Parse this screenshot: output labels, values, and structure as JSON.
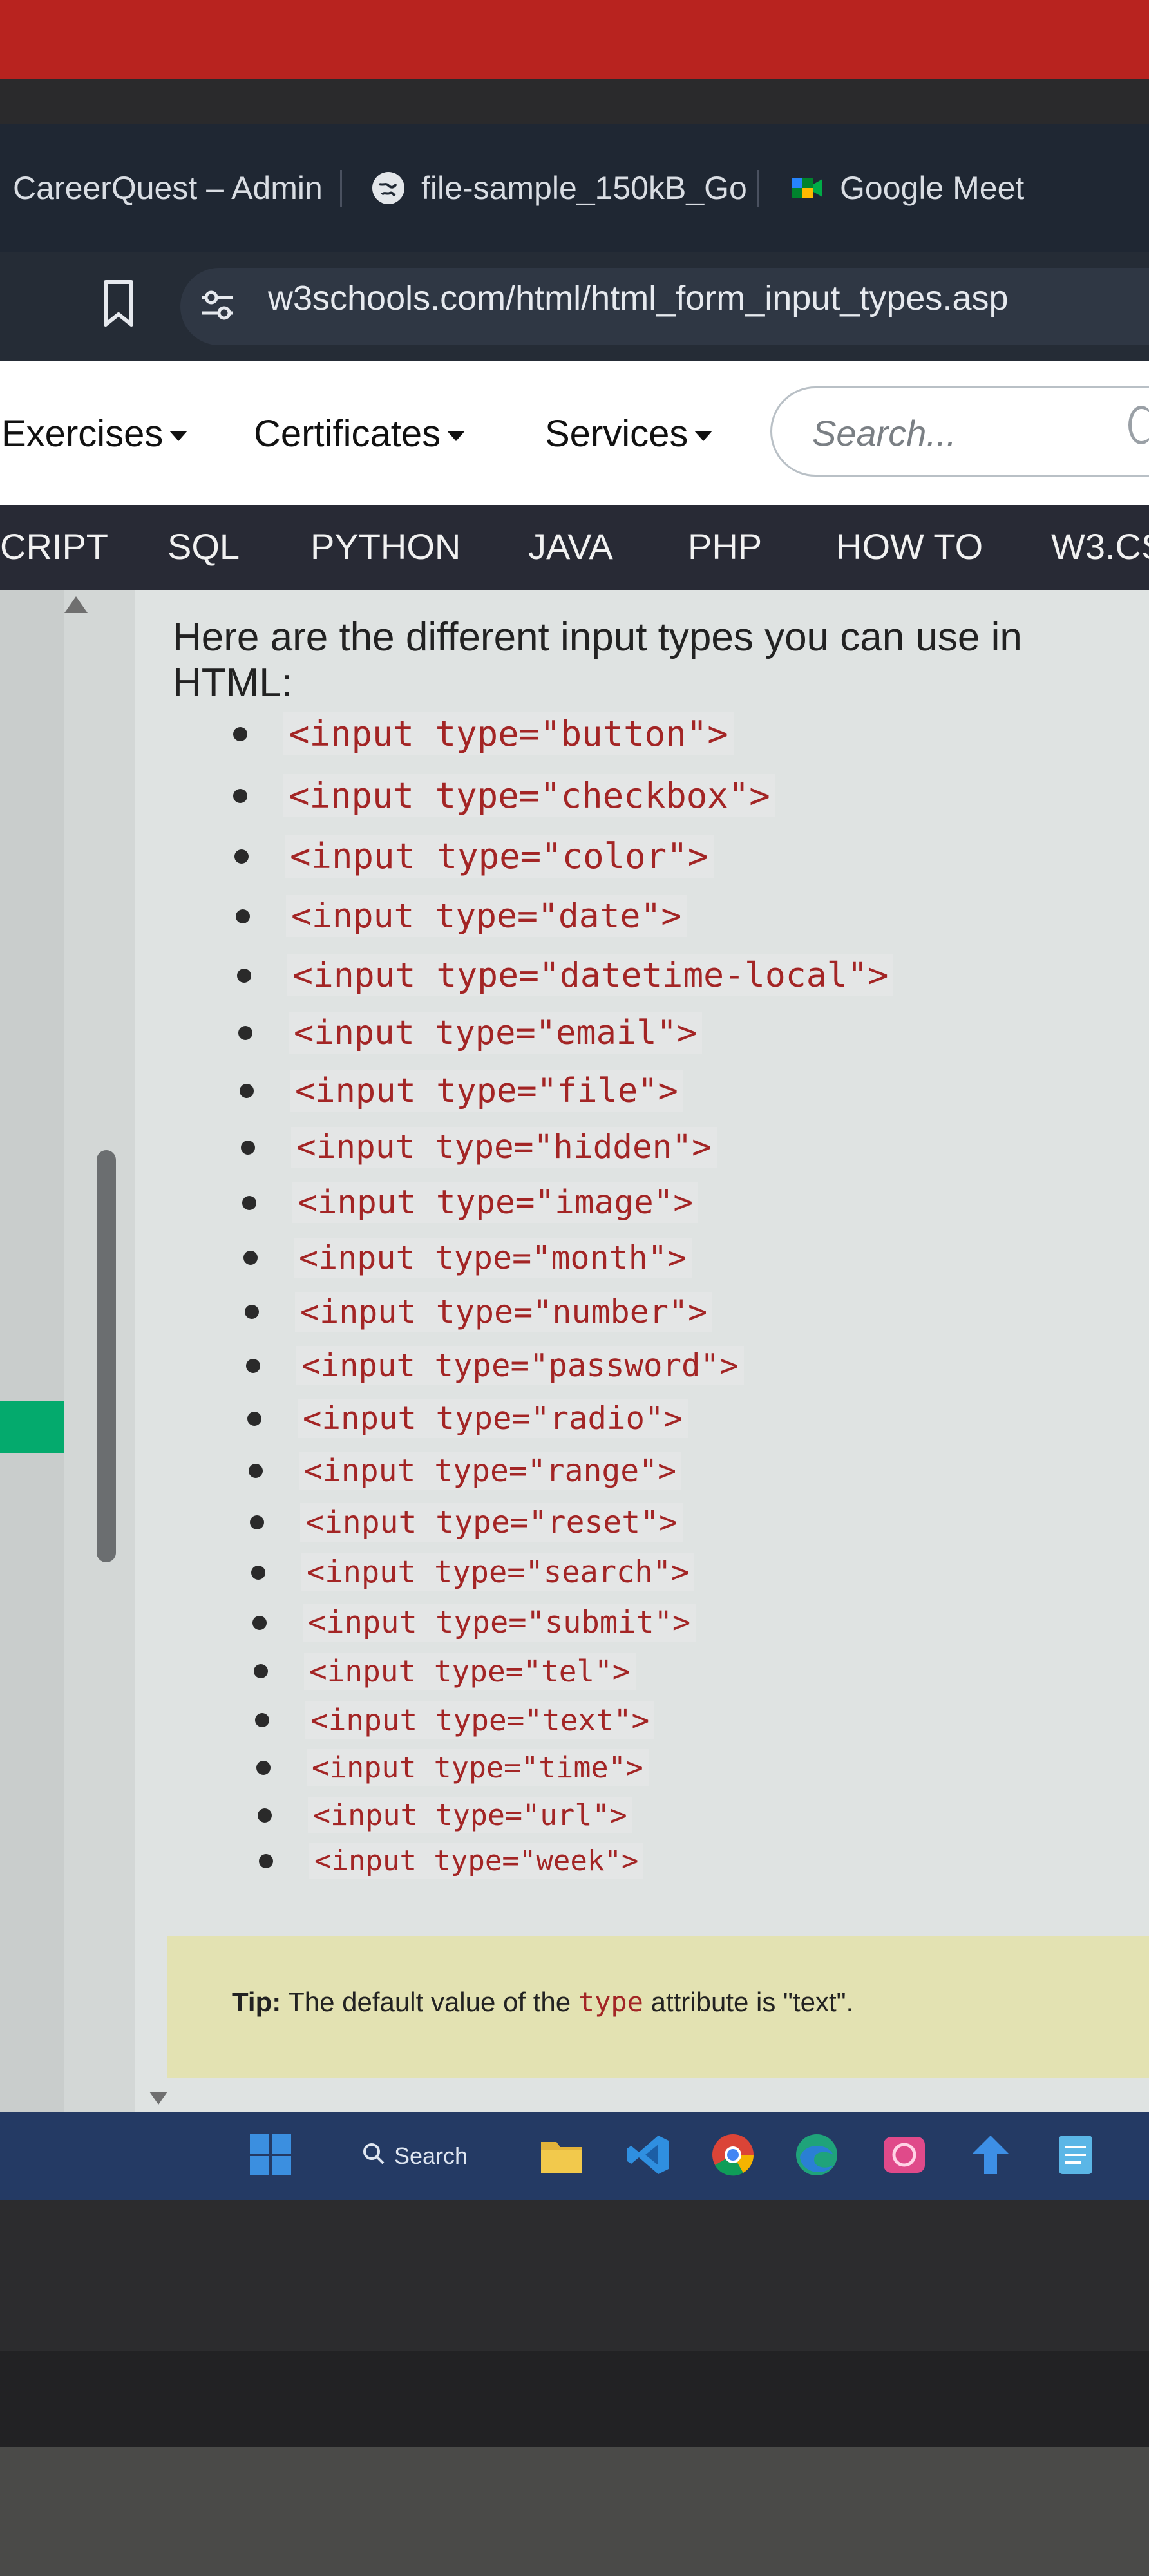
{
  "browser": {
    "tabs": [
      {
        "label": "CareerQuest – Admin"
      },
      {
        "label": "file-sample_150kB_Go"
      },
      {
        "label": "Google Meet"
      }
    ],
    "url": "w3schools.com/html/html_form_input_types.asp"
  },
  "w3_nav": {
    "items": [
      "Exercises",
      "Certificates",
      "Services"
    ],
    "search_placeholder": "Search..."
  },
  "subjects": [
    "CRIPT",
    "SQL",
    "PYTHON",
    "JAVA",
    "PHP",
    "HOW TO",
    "W3.CS"
  ],
  "content": {
    "intro": "Here are the different input types you can use in HTML:",
    "input_types": [
      "<input type=\"button\">",
      "<input type=\"checkbox\">",
      "<input type=\"color\">",
      "<input type=\"date\">",
      "<input type=\"datetime-local\">",
      "<input type=\"email\">",
      "<input type=\"file\">",
      "<input type=\"hidden\">",
      "<input type=\"image\">",
      "<input type=\"month\">",
      "<input type=\"number\">",
      "<input type=\"password\">",
      "<input type=\"radio\">",
      "<input type=\"range\">",
      "<input type=\"reset\">",
      "<input type=\"search\">",
      "<input type=\"submit\">",
      "<input type=\"tel\">",
      "<input type=\"text\">",
      "<input type=\"time\">",
      "<input type=\"url\">",
      "<input type=\"week\">"
    ],
    "tip": {
      "label": "Tip:",
      "text_before": " The default value of the ",
      "code": "type",
      "text_after": " attribute is \"text\"."
    }
  },
  "taskbar": {
    "search_label": "Search",
    "icons": [
      "start-icon",
      "search-icon",
      "file-explorer-icon",
      "vscode-icon",
      "chrome-icon",
      "edge-icon",
      "app-icon",
      "arrow-app-icon",
      "notepad-icon"
    ]
  },
  "colors": {
    "w3_green": "#04aa6d",
    "code_red": "#a32525",
    "tip_bg": "#e3e2b2",
    "subject_bar": "#282a35"
  }
}
